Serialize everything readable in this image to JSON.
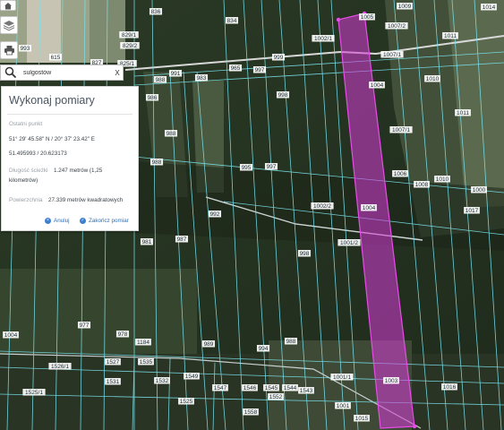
{
  "search": {
    "value": "sulgostów",
    "clear_label": "X"
  },
  "panel": {
    "title": "Wykonaj pomiary",
    "last_point_label": "Ostatni punkt",
    "coords_dms": "51° 29' 45.58\" N / 20° 37' 23.42\" E",
    "coords_decimal": "51.495993 / 20.623173",
    "path_length_label": "Długość ścieżki",
    "path_length_value_line1": "1.247 metrów (1,25",
    "path_length_value_line2": "kilometrów)",
    "area_label": "Powierzchnia",
    "area_value": "27.339 metrów kwadratowych",
    "cancel_label": "Anuluj",
    "finish_label": "Zakończ pomiar"
  },
  "map": {
    "measure_color": "#d63ad6",
    "parcel_line_color": "#78e2ec",
    "parcel_labels": [
      "836",
      "834",
      "1005",
      "1009",
      "1014",
      "829/1",
      "829/2",
      "827",
      "1002/1",
      "1007/2",
      "1011",
      "993",
      "615",
      "825/1",
      "1007/1",
      "991",
      "965",
      "997",
      "999",
      "988",
      "983",
      "1010",
      "986",
      "1007/1",
      "988",
      "998",
      "1011",
      "1004",
      "1006",
      "1008",
      "1010",
      "1000",
      "988",
      "995",
      "997",
      "992",
      "1017",
      "1002/2",
      "1004",
      "1001/2",
      "987",
      "981",
      "998",
      "977",
      "978",
      "1184",
      "989",
      "994",
      "988",
      "1004",
      "1526/1",
      "1527",
      "1531",
      "1535",
      "1532",
      "1549",
      "1547",
      "1546",
      "1545",
      "1544",
      "1543",
      "1001/1",
      "1003",
      "1016",
      "1525",
      "1552",
      "1558",
      "1001",
      "1015",
      "1525/1"
    ]
  }
}
